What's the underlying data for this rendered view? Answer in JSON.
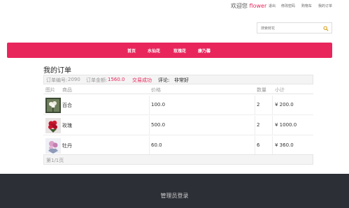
{
  "topbar": {
    "welcome_prefix": "欢迎您",
    "username": "flower",
    "links": [
      "退出",
      "修改密码",
      "购物车",
      "我的订单"
    ]
  },
  "search": {
    "placeholder": "搜索鲜花",
    "icon": "search-icon"
  },
  "nav": {
    "items": [
      "首页",
      "水仙花",
      "玫瑰花",
      "康乃馨"
    ]
  },
  "page_title": "我的订单",
  "order": {
    "number_label": "订单编号:",
    "number": "2090",
    "amount_label": "订单金额:",
    "amount": "1560.0",
    "status": "交易成功",
    "review_label": "评论:",
    "review": "非常好"
  },
  "table": {
    "headers": {
      "image": "图片",
      "product": "商品",
      "price": "价格",
      "quantity": "数量",
      "subtotal": "小计"
    },
    "rows": [
      {
        "name": "百合",
        "price": "100.0",
        "quantity": "2",
        "subtotal": "¥ 200.0"
      },
      {
        "name": "玫瑰",
        "price": "500.0",
        "quantity": "2",
        "subtotal": "¥ 1000.0"
      },
      {
        "name": "牡丹",
        "price": "60.0",
        "quantity": "6",
        "subtotal": "¥ 360.0"
      }
    ]
  },
  "pagination": "第1/1页",
  "footer": {
    "admin_login": "管理员登录"
  },
  "colors": {
    "accent": "#e8265c",
    "footer_bg": "#2c2f36"
  }
}
